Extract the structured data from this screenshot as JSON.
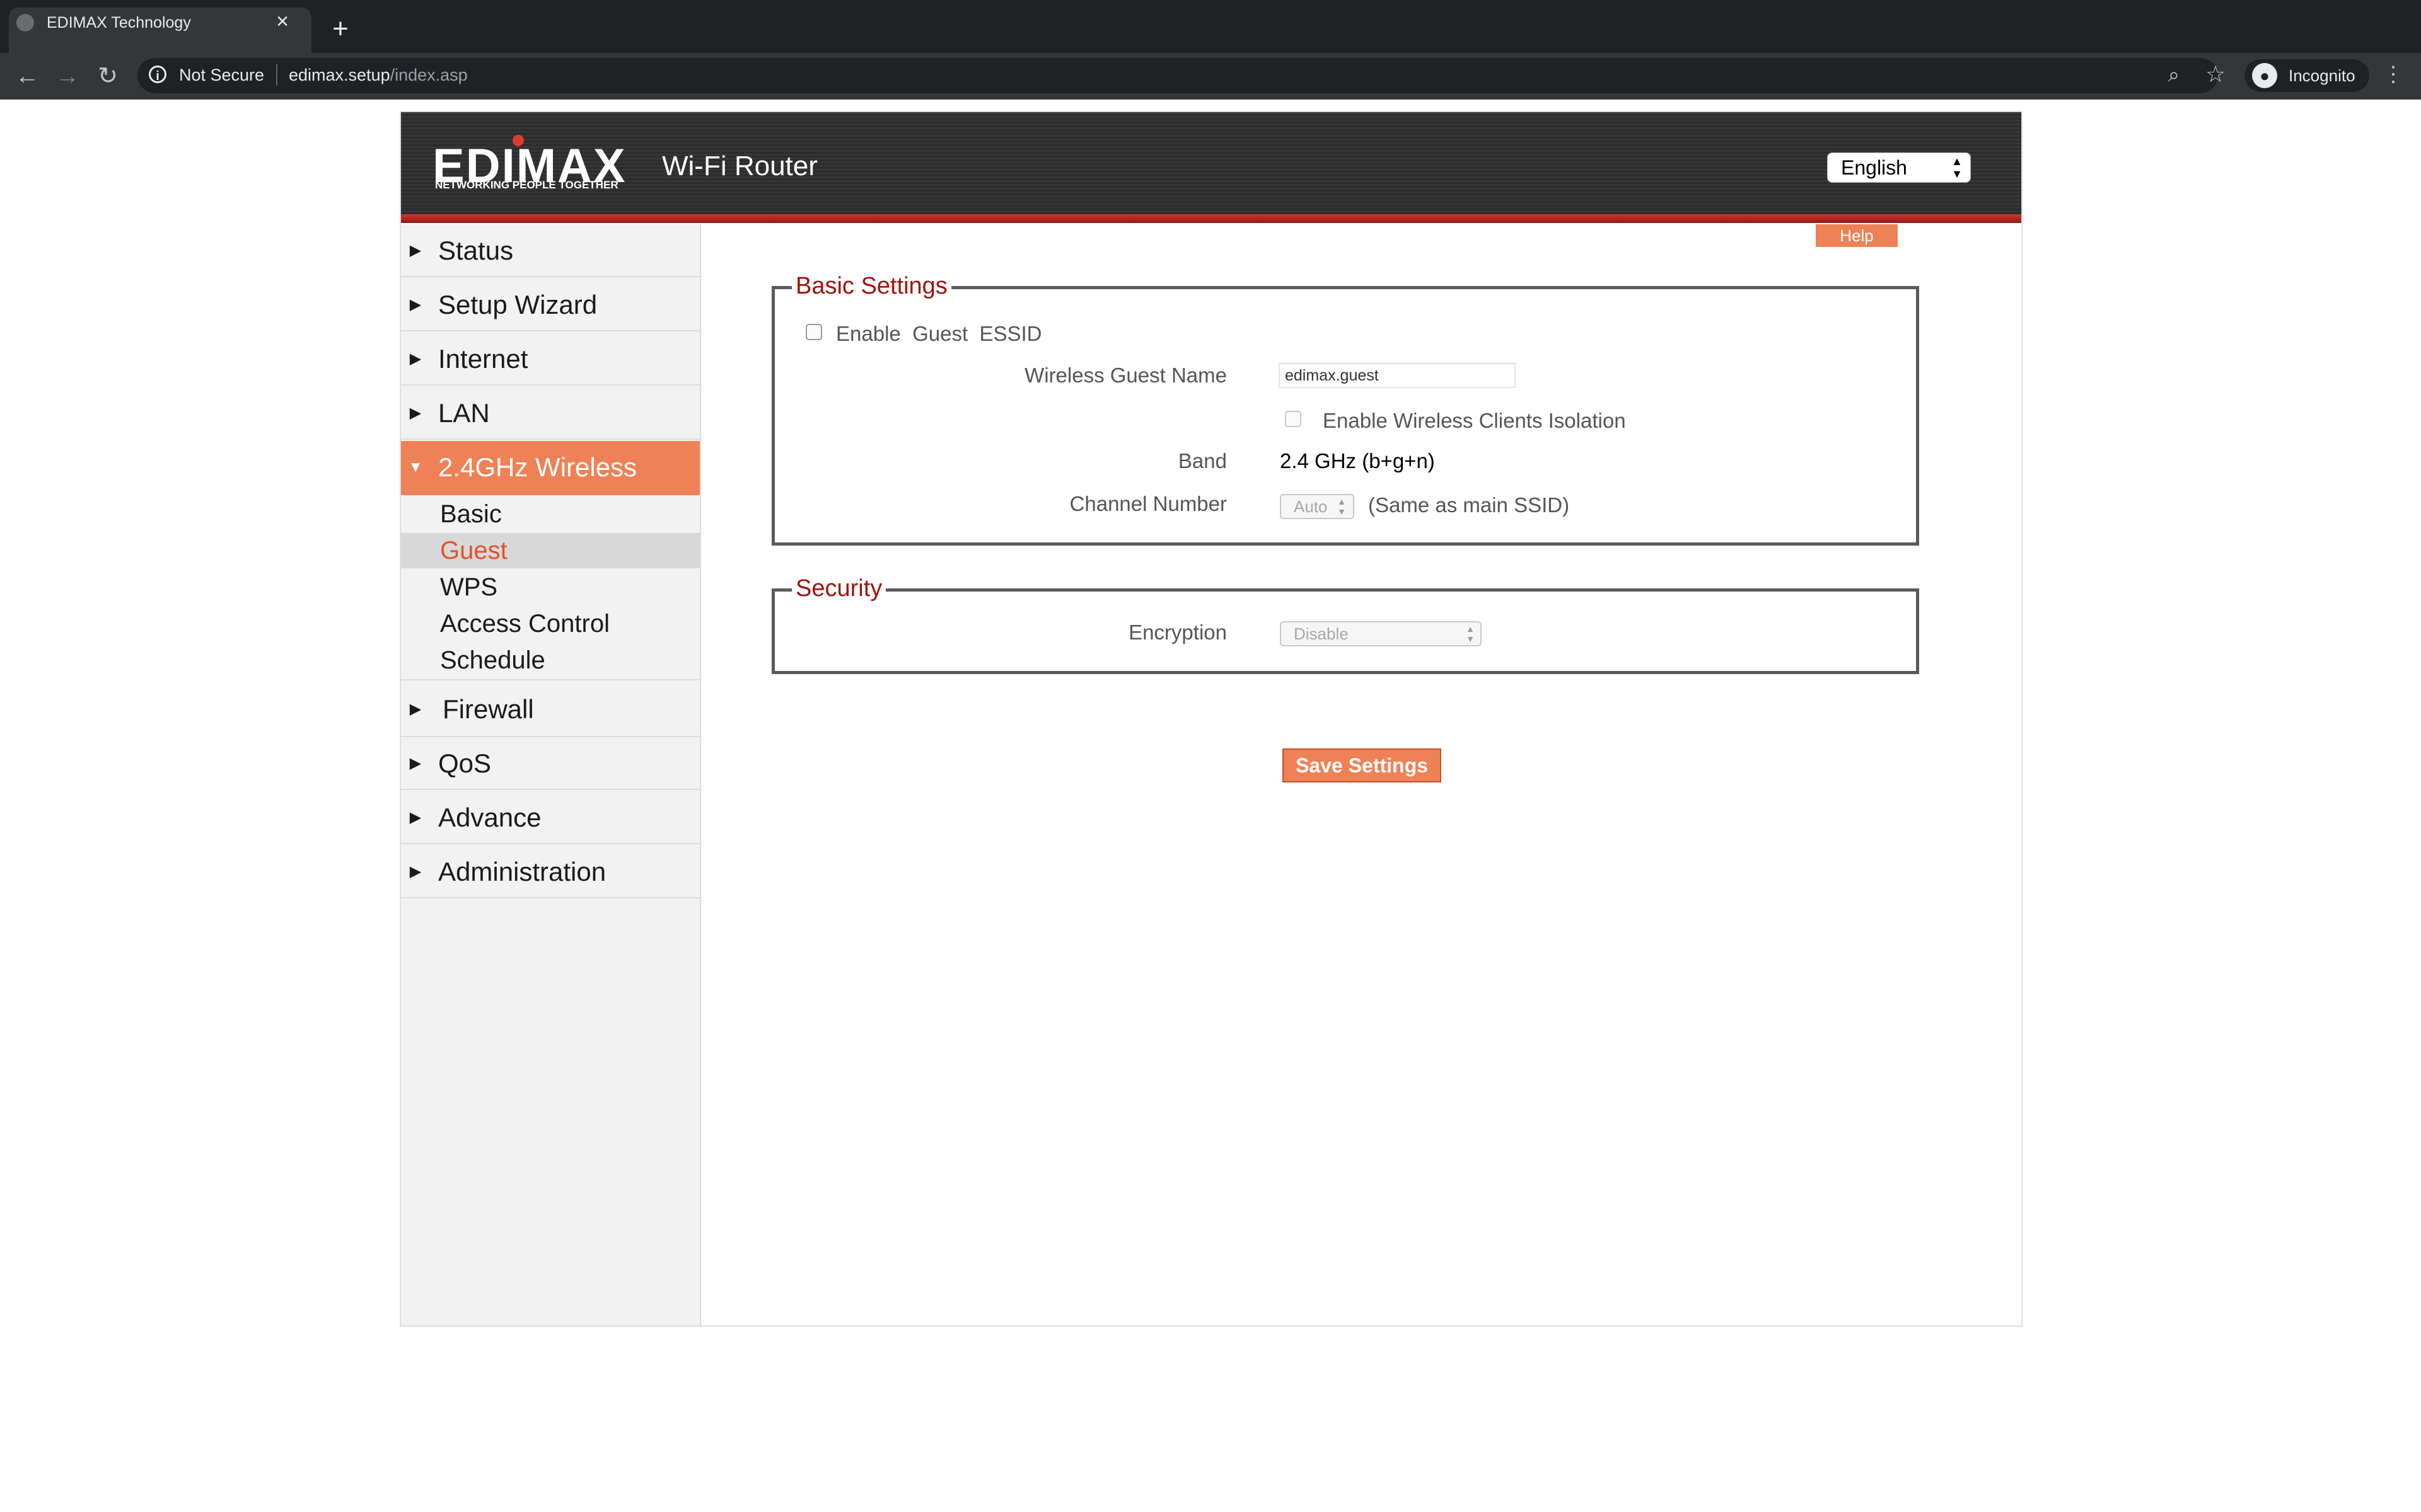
{
  "browser": {
    "tab_title": "EDIMAX Technology",
    "tab_close": "×",
    "new_tab": "+",
    "back": "←",
    "forward": "→",
    "reload": "↻",
    "security_label": "Not Secure",
    "url_host": "edimax.setup",
    "url_path": "/index.asp",
    "incognito_label": "Incognito",
    "menu": "⋮"
  },
  "header": {
    "logo_text": "EDIMAX",
    "logo_tagline": "NETWORKING PEOPLE TOGETHER",
    "product": "Wi-Fi Router",
    "language": "English"
  },
  "sidebar": {
    "items": [
      {
        "label": "Status"
      },
      {
        "label": "Setup Wizard"
      },
      {
        "label": "Internet"
      },
      {
        "label": "LAN"
      },
      {
        "label": "2.4GHz Wireless"
      },
      {
        "label": "Firewall"
      },
      {
        "label": "QoS"
      },
      {
        "label": "Advance"
      },
      {
        "label": "Administration"
      }
    ],
    "sub_items": [
      {
        "label": "Basic"
      },
      {
        "label": "Guest"
      },
      {
        "label": "WPS"
      },
      {
        "label": "Access Control"
      },
      {
        "label": "Schedule"
      }
    ]
  },
  "content": {
    "help_label": "Help",
    "basic": {
      "legend": "Basic Settings",
      "enable_guest_label": "Enable  Guest  ESSID",
      "enable_guest_checked": false,
      "guest_name_label": "Wireless Guest Name",
      "guest_name_value": "edimax.guest",
      "isolation_label": "Enable Wireless Clients Isolation",
      "isolation_checked": false,
      "band_label": "Band",
      "band_value": "2.4 GHz (b+g+n)",
      "channel_label": "Channel Number",
      "channel_value": "Auto",
      "channel_note": "(Same as main SSID)"
    },
    "security": {
      "legend": "Security",
      "encryption_label": "Encryption",
      "encryption_value": "Disable"
    },
    "save_label": "Save Settings"
  },
  "colors": {
    "accent": "#ef8156",
    "legend_red": "#a0140e",
    "header_dark": "#2c2c2c",
    "header_red_line": "#d7322a"
  }
}
